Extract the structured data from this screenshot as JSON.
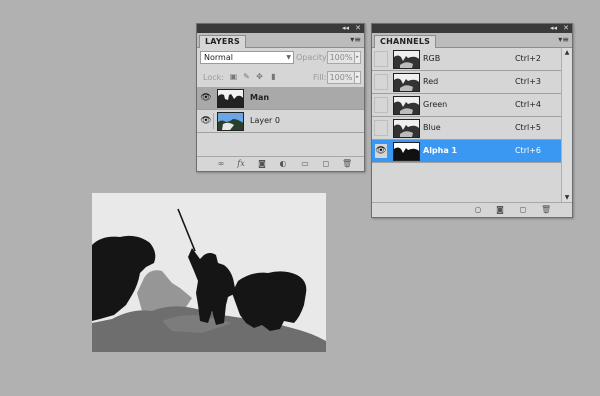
{
  "layers_panel": {
    "tab": "LAYERS",
    "menu_icon": "panel-menu-icon",
    "blend_mode": "Normal",
    "opacity_label": "Opacity:",
    "opacity_value": "100%",
    "lock_label": "Lock:",
    "fill_label": "Fill:",
    "fill_value": "100%",
    "layers": [
      {
        "name": "Man",
        "visible": true,
        "selected": true,
        "bold": true
      },
      {
        "name": "Layer 0",
        "visible": true,
        "selected": false,
        "bold": false
      }
    ],
    "footer_icons": [
      "link-icon",
      "fx-icon",
      "mask-icon",
      "adjustment-icon",
      "folder-icon",
      "new-layer-icon",
      "trash-icon"
    ]
  },
  "channels_panel": {
    "tab": "CHANNELS",
    "channels": [
      {
        "name": "RGB",
        "shortcut": "Ctrl+2",
        "visible": false,
        "selected": false
      },
      {
        "name": "Red",
        "shortcut": "Ctrl+3",
        "visible": false,
        "selected": false
      },
      {
        "name": "Green",
        "shortcut": "Ctrl+4",
        "visible": false,
        "selected": false
      },
      {
        "name": "Blue",
        "shortcut": "Ctrl+5",
        "visible": false,
        "selected": false
      },
      {
        "name": "Alpha 1",
        "shortcut": "Ctrl+6",
        "visible": true,
        "selected": true
      }
    ],
    "footer_icons": [
      "load-selection-icon",
      "save-selection-icon",
      "new-channel-icon",
      "trash-icon"
    ]
  },
  "colors": {
    "background": "#b1b1b1",
    "panel": "#d6d6d6",
    "selected_layer": "#a9a9a9",
    "selected_channel": "#3a98f3",
    "silhouette_dark": "#151515",
    "silhouette_mid": "#6e6e6e",
    "silhouette_light": "#969696"
  }
}
